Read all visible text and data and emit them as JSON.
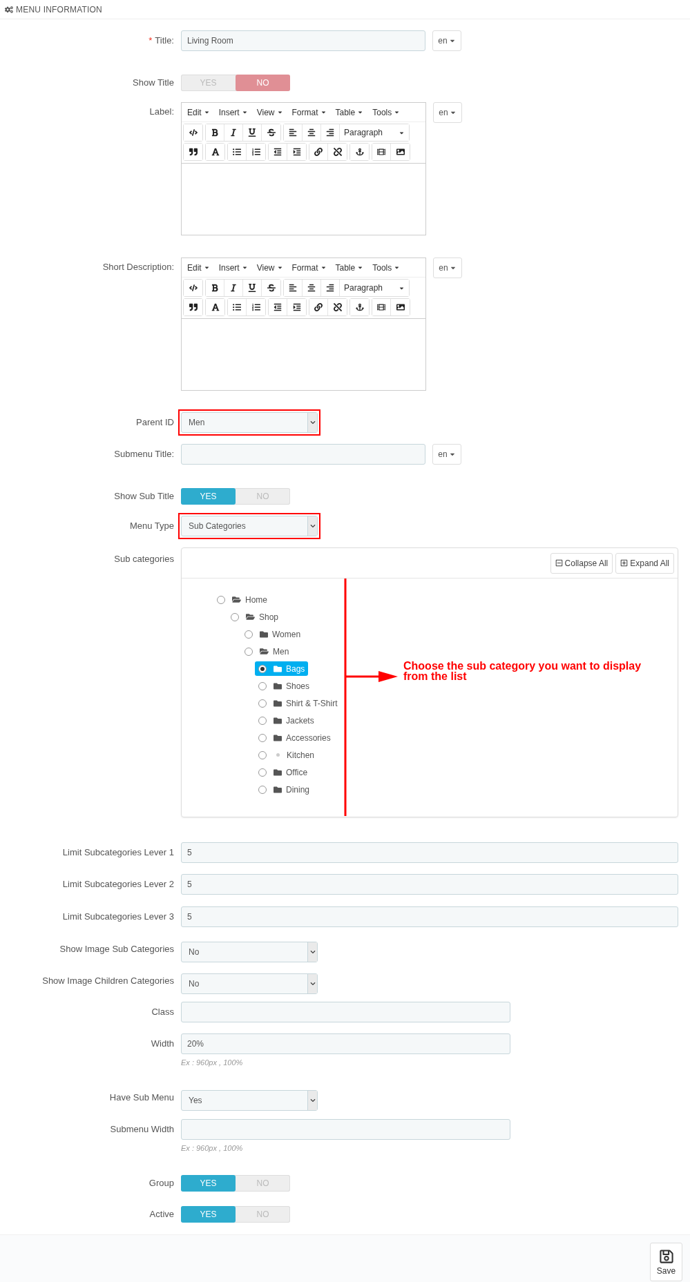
{
  "header": {
    "title": "MENU INFORMATION"
  },
  "fields": [
    {
      "kind": "translatable",
      "label": "Title:",
      "required_mark": "*",
      "value": "Living Room",
      "lang": "en"
    },
    {
      "kind": "toggle",
      "label": "Show Title",
      "options": [
        {
          "label": "YES",
          "selected": false
        },
        {
          "label": "NO",
          "selected": true
        }
      ]
    },
    {
      "kind": "editor",
      "label": "Label:",
      "menus": [
        "Edit",
        "Insert",
        "View",
        "Format",
        "Table",
        "Tools"
      ],
      "block_format": "Paragraph",
      "lang": "en"
    },
    {
      "kind": "editor",
      "label": "Short Description:",
      "menus": [
        "Edit",
        "Insert",
        "View",
        "Format",
        "Table",
        "Tools"
      ],
      "block_format": "Paragraph",
      "lang": "en"
    },
    {
      "kind": "select",
      "label": "Parent ID",
      "value": "Men",
      "highlighted": true
    },
    {
      "kind": "translatable",
      "label": "Submenu Title:",
      "lang": "en"
    },
    {
      "kind": "toggle",
      "label": "Show Sub Title",
      "options": [
        {
          "label": "YES",
          "selected": true
        },
        {
          "label": "NO",
          "selected": false
        }
      ]
    },
    {
      "kind": "select",
      "label": "Menu Type",
      "value": "Sub Categories",
      "highlighted": true
    },
    {
      "kind": "tree",
      "label": "Sub categories",
      "buttons": [
        "Collapse All",
        "Expand All"
      ],
      "annotation": "Choose the sub category you want to display from the list",
      "nodes": [
        {
          "label": "Home",
          "kind": "folder",
          "expanded": true,
          "selected": false,
          "children": [
            {
              "label": "Shop",
              "kind": "folder",
              "expanded": true,
              "selected": false,
              "children": [
                {
                  "label": "Women",
                  "kind": "folder",
                  "expanded": false,
                  "selected": false
                },
                {
                  "label": "Men",
                  "kind": "folder",
                  "expanded": true,
                  "selected": false,
                  "children": [
                    {
                      "label": "Bags",
                      "kind": "folder",
                      "expanded": false,
                      "selected": true
                    },
                    {
                      "label": "Shoes",
                      "kind": "folder",
                      "expanded": false,
                      "selected": false
                    },
                    {
                      "label": "Shirt & T-Shirt",
                      "kind": "folder",
                      "expanded": false,
                      "selected": false
                    },
                    {
                      "label": "Jackets",
                      "kind": "folder",
                      "expanded": false,
                      "selected": false
                    },
                    {
                      "label": "Accessories",
                      "kind": "folder",
                      "expanded": false,
                      "selected": false
                    },
                    {
                      "label": "Kitchen",
                      "kind": "leaf",
                      "selected": false
                    },
                    {
                      "label": "Office",
                      "kind": "folder",
                      "expanded": false,
                      "selected": false
                    },
                    {
                      "label": "Dining",
                      "kind": "folder",
                      "expanded": false,
                      "selected": false
                    }
                  ]
                }
              ]
            }
          ]
        }
      ]
    },
    {
      "kind": "number",
      "label": "Limit Subcategories Lever 1",
      "value": "5"
    },
    {
      "kind": "number",
      "label": "Limit Subcategories Lever 2",
      "value": "5"
    },
    {
      "kind": "number",
      "label": "Limit Subcategories Lever 3",
      "value": "5"
    },
    {
      "kind": "select",
      "label": "Show Image Sub Categories",
      "value": "No",
      "highlighted": false
    },
    {
      "kind": "select",
      "label": "Show Image Children Categories",
      "value": "No",
      "highlighted": false
    },
    {
      "kind": "text",
      "label": "Class"
    },
    {
      "kind": "text",
      "label": "Width",
      "value": "20%",
      "hint": "Ex : 960px , 100%"
    },
    {
      "kind": "select",
      "label": "Have Sub Menu",
      "value": "Yes",
      "highlighted": false
    },
    {
      "kind": "text",
      "label": "Submenu Width",
      "hint": "Ex : 960px , 100%"
    },
    {
      "kind": "toggle",
      "label": "Group",
      "options": [
        {
          "label": "YES",
          "selected": true
        },
        {
          "label": "NO",
          "selected": false
        }
      ]
    },
    {
      "kind": "toggle",
      "label": "Active",
      "options": [
        {
          "label": "YES",
          "selected": true
        },
        {
          "label": "NO",
          "selected": false
        }
      ]
    }
  ],
  "footer": {
    "save": "Save"
  }
}
